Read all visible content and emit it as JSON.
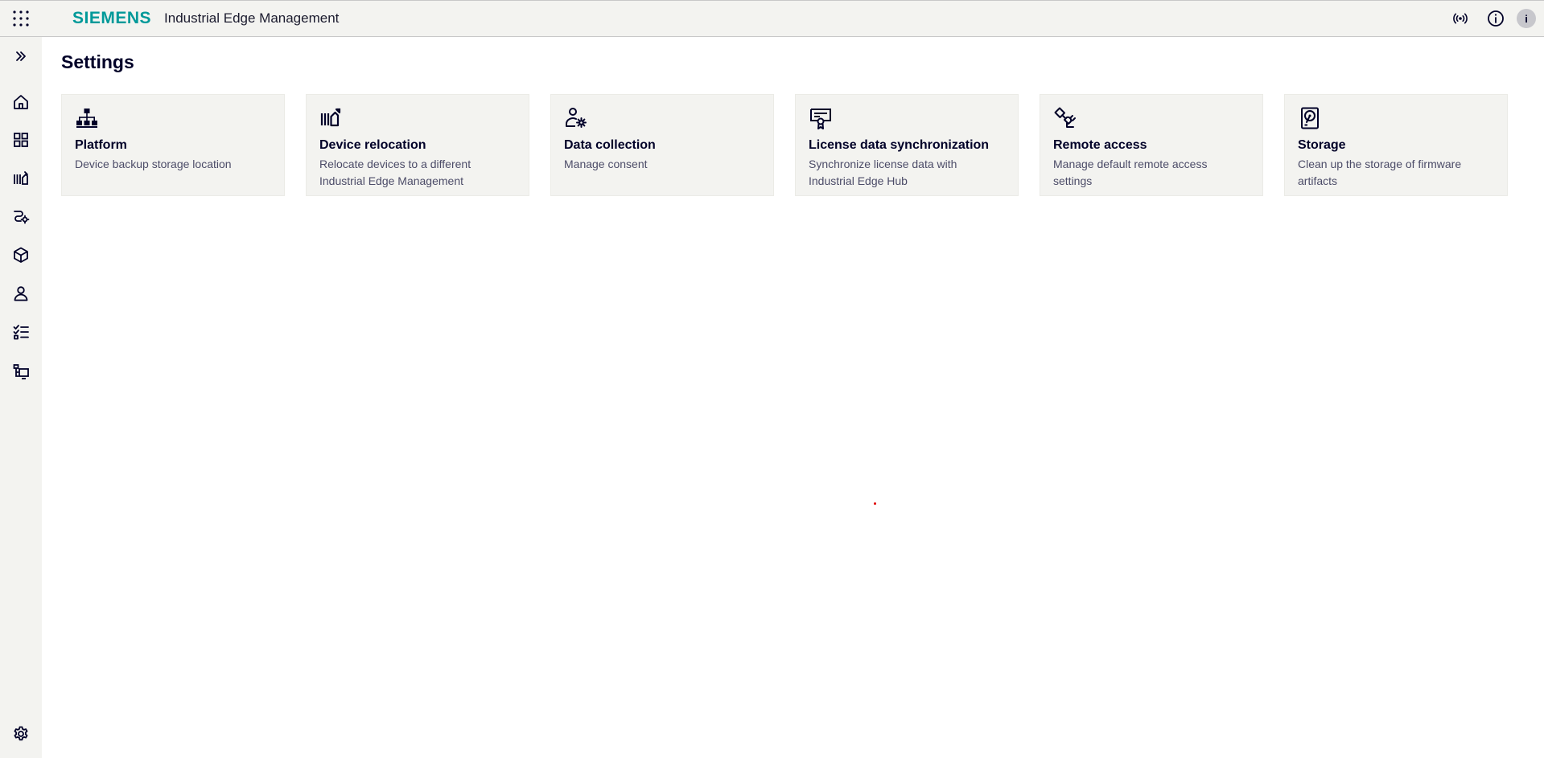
{
  "header": {
    "brand": "SIEMENS",
    "app_name": "Industrial Edge Management",
    "avatar_initial": "i"
  },
  "sidebar": {
    "items": [
      {
        "name": "expand",
        "icon": "double-chevron-right-icon"
      },
      {
        "name": "home",
        "icon": "home-icon"
      },
      {
        "name": "apps",
        "icon": "grid-icon"
      },
      {
        "name": "devices",
        "icon": "device-relocation-icon"
      },
      {
        "name": "connections",
        "icon": "connector-gear-icon"
      },
      {
        "name": "catalog",
        "icon": "cube-icon"
      },
      {
        "name": "users",
        "icon": "user-icon"
      },
      {
        "name": "jobs",
        "icon": "checklist-icon"
      },
      {
        "name": "monitoring",
        "icon": "network-screen-icon"
      },
      {
        "name": "settings",
        "icon": "gear-icon"
      }
    ]
  },
  "page": {
    "title": "Settings"
  },
  "cards": [
    {
      "title": "Platform",
      "description": "Device backup storage location",
      "icon": "hierarchy-icon"
    },
    {
      "title": "Device relocation",
      "description": "Relocate devices to a different Industrial Edge Management",
      "icon": "device-relocation-icon"
    },
    {
      "title": "Data collection",
      "description": "Manage consent",
      "icon": "user-gear-icon"
    },
    {
      "title": "License data synchronization",
      "description": "Synchronize license data with Industrial Edge Hub",
      "icon": "certificate-icon"
    },
    {
      "title": "Remote access",
      "description": "Manage default remote access settings",
      "icon": "plug-icon"
    },
    {
      "title": "Storage",
      "description": "Clean up the storage of firmware artifacts",
      "icon": "hard-disk-icon"
    }
  ],
  "colors": {
    "brand": "#009999",
    "header_bg": "#f3f3f0",
    "card_bg": "#f3f3f0",
    "text_primary": "#000028",
    "text_secondary": "#4c4c68"
  }
}
